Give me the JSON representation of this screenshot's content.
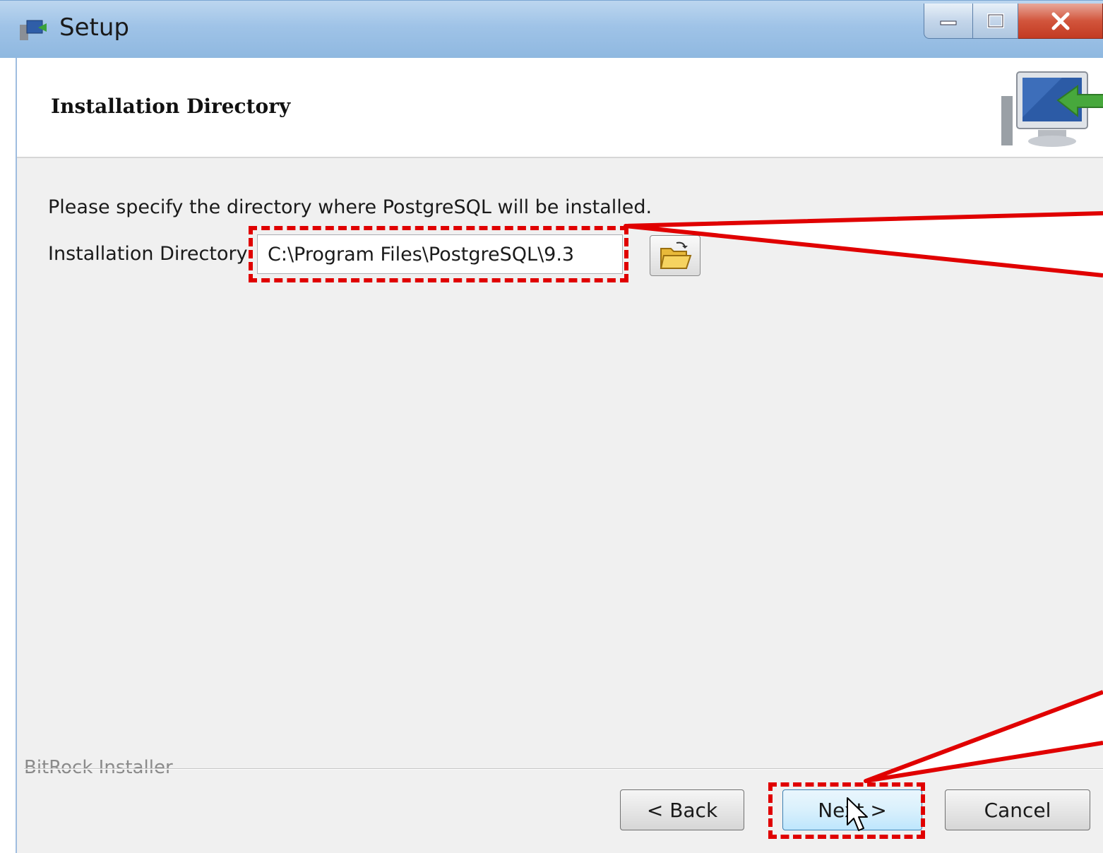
{
  "window": {
    "title": "Setup",
    "controls": {
      "minimize_icon": "minimize-icon",
      "maximize_icon": "maximize-icon",
      "close_icon": "close-icon"
    }
  },
  "header": {
    "title": "Installation Directory",
    "graphic_icon": "computer-install-arrow-icon"
  },
  "main": {
    "instruction": "Please specify the directory where PostgreSQL will be installed.",
    "directory_label": "Installation Directory",
    "directory_value": "C:\\Program Files\\PostgreSQL\\9.3",
    "browse_icon": "folder-open-icon"
  },
  "footer": {
    "branding": "BitRock Installer",
    "back_label": "< Back",
    "next_label": "Next >",
    "cancel_label": "Cancel"
  },
  "annotations": {
    "highlight_color": "#e00000",
    "callout_fill": "#ffffff"
  }
}
